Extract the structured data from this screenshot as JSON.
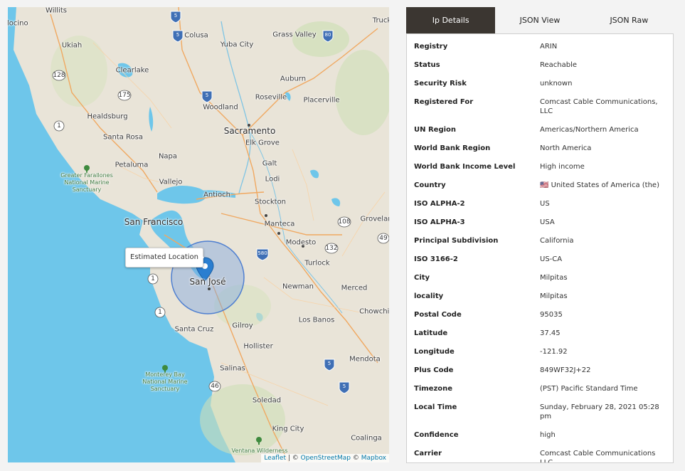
{
  "map": {
    "tooltip": "Estimated Location",
    "attribution": {
      "leaflet": "Leaflet",
      "separator": " | © ",
      "osm": "OpenStreetMap",
      "separator2": " © ",
      "mapbox": "Mapbox"
    },
    "labels": {
      "willits": "Willits",
      "docino": "docino",
      "ukiah": "Ukiah",
      "clearlake": "Clearlake",
      "healdsburg": "Healdsburg",
      "santa_rosa": "Santa Rosa",
      "petaluma": "Petaluma",
      "napa": "Napa",
      "vallejo": "Vallejo",
      "san_francisco": "San Francisco",
      "farallones": "Greater Farallones National Marine Sanctuary",
      "colusa": "Colusa",
      "yuba_city": "Yuba City",
      "grass_valley": "Grass Valley",
      "truck": "Truck",
      "auburn": "Auburn",
      "roseville": "Roseville",
      "placerville": "Placerville",
      "woodland": "Woodland",
      "sacramento": "Sacramento",
      "elk_grove": "Elk Grove",
      "galt": "Galt",
      "lodi": "Lodi",
      "antioch": "Antioch",
      "stockton": "Stockton",
      "manteca": "Manteca",
      "groveland": "Grovelan",
      "modesto": "Modesto",
      "turlock": "Turlock",
      "san_jose": "San José",
      "newman": "Newman",
      "merced": "Merced",
      "chowchilla": "Chowchill",
      "los_banos": "Los Banos",
      "santa_cruz": "Santa Cruz",
      "gilroy": "Gilroy",
      "hollister": "Hollister",
      "salinas": "Salinas",
      "mendota": "Mendota",
      "monterey_bay": "Monterey Bay National Marine Sanctuary",
      "soledad": "Soledad",
      "king_city": "King City",
      "coalinga": "Coalinga",
      "ventana": "Ventana Wilderness",
      "sh_128": "128",
      "sh_175": "175",
      "sh_1a": "1",
      "sh_1b": "1",
      "sh_1c": "1",
      "sh_108": "108",
      "sh_132": "132",
      "sh_49": "49",
      "sh_46": "46",
      "i_5a": "5",
      "i_5b": "5",
      "i_5c": "5",
      "i_5d": "5",
      "i_5e": "5",
      "i_80": "80",
      "i_580": "580"
    }
  },
  "tabs": [
    "Ip Details",
    "JSON View",
    "JSON Raw"
  ],
  "details": [
    {
      "key": "Registry",
      "value": "ARIN"
    },
    {
      "key": "Status",
      "value": "Reachable"
    },
    {
      "key": "Security Risk",
      "value": "unknown"
    },
    {
      "key": "Registered For",
      "value": "Comcast Cable Communications, LLC"
    },
    {
      "key": "UN Region",
      "value": "Americas/Northern America"
    },
    {
      "key": "World Bank Region",
      "value": "North America"
    },
    {
      "key": "World Bank Income Level",
      "value": "High income"
    },
    {
      "key": "Country",
      "value": "🇺🇸 United States of America (the)"
    },
    {
      "key": "ISO ALPHA-2",
      "value": "US"
    },
    {
      "key": "ISO ALPHA-3",
      "value": "USA"
    },
    {
      "key": "Principal Subdivision",
      "value": "California"
    },
    {
      "key": "ISO 3166-2",
      "value": "US-CA"
    },
    {
      "key": "City",
      "value": "Milpitas"
    },
    {
      "key": "locality",
      "value": "Milpitas"
    },
    {
      "key": "Postal Code",
      "value": "95035"
    },
    {
      "key": "Latitude",
      "value": "37.45"
    },
    {
      "key": "Longitude",
      "value": "-121.92"
    },
    {
      "key": "Plus Code",
      "value": "849WF32J+22"
    },
    {
      "key": "Timezone",
      "value": "(PST) Pacific Standard Time"
    },
    {
      "key": "Local Time",
      "value": "Sunday, February 28, 2021 05:28 pm"
    },
    {
      "key": "Confidence",
      "value": "high"
    },
    {
      "key": "Carrier",
      "value": "Comcast Cable Communications LLC"
    }
  ],
  "colors": {
    "water": "#6ec6ea",
    "land": "#e9e4d8",
    "tab_active": "#3b3631",
    "radius_fill": "#7ea6e0",
    "marker": "#2a7ed0",
    "interstate": "#3f6fb5"
  }
}
